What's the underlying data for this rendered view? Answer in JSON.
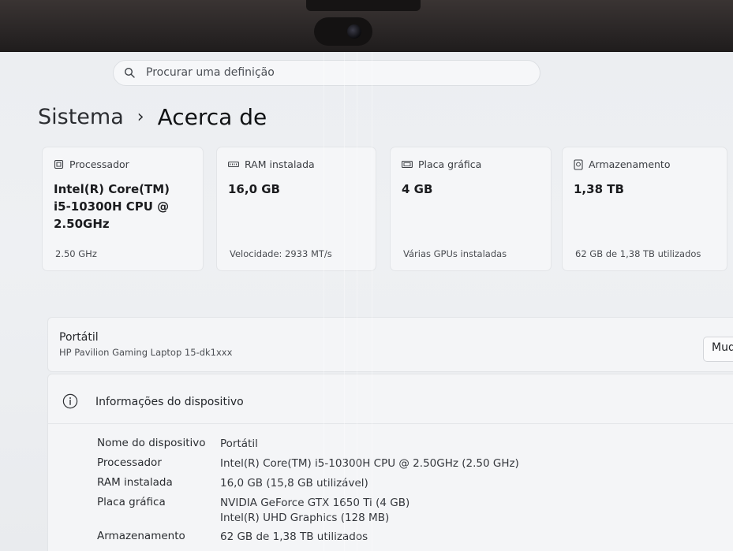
{
  "search": {
    "placeholder": "Procurar uma definição"
  },
  "breadcrumb": {
    "parent": "Sistema",
    "separator": "›",
    "current": "Acerca de"
  },
  "cards": [
    {
      "icon": "processor-icon",
      "title": "Processador",
      "value_lines": [
        "Intel(R) Core(TM)",
        "i5-10300H CPU @",
        "2.50GHz"
      ],
      "sub": "2.50 GHz"
    },
    {
      "icon": "ram-icon",
      "title": "RAM instalada",
      "value_lines": [
        "16,0 GB"
      ],
      "sub": "Velocidade: 2933 MT/s"
    },
    {
      "icon": "graphics-card-icon",
      "title": "Placa gráfica",
      "value_lines": [
        "4 GB"
      ],
      "sub": "Várias GPUs instaladas"
    },
    {
      "icon": "storage-icon",
      "title": "Armazenamento",
      "value_lines": [
        "1,38 TB"
      ],
      "sub": "62 GB de 1,38 TB utilizados"
    }
  ],
  "device": {
    "type": "Portátil",
    "model": "HP Pavilion Gaming Laptop 15-dk1xxx",
    "rename_label": "Mud"
  },
  "info": {
    "title": "Informações do dispositivo",
    "rows": [
      {
        "label": "Nome do dispositivo",
        "value": [
          "Portátil"
        ]
      },
      {
        "label": "Processador",
        "value": [
          "Intel(R) Core(TM) i5-10300H CPU @ 2.50GHz (2.50 GHz)"
        ]
      },
      {
        "label": "RAM instalada",
        "value": [
          "16,0 GB (15,8 GB utilizável)"
        ]
      },
      {
        "label": "Placa gráfica",
        "value": [
          "NVIDIA GeForce GTX 1650 Ti (4 GB)",
          "Intel(R) UHD Graphics (128 MB)"
        ]
      },
      {
        "label": "Armazenamento",
        "value": [
          "62 GB de 1,38 TB utilizados"
        ]
      }
    ]
  },
  "colors": {
    "screen_background": "#eceef1",
    "card_background": "#f5f6f8",
    "bezel": "#2a2626"
  }
}
